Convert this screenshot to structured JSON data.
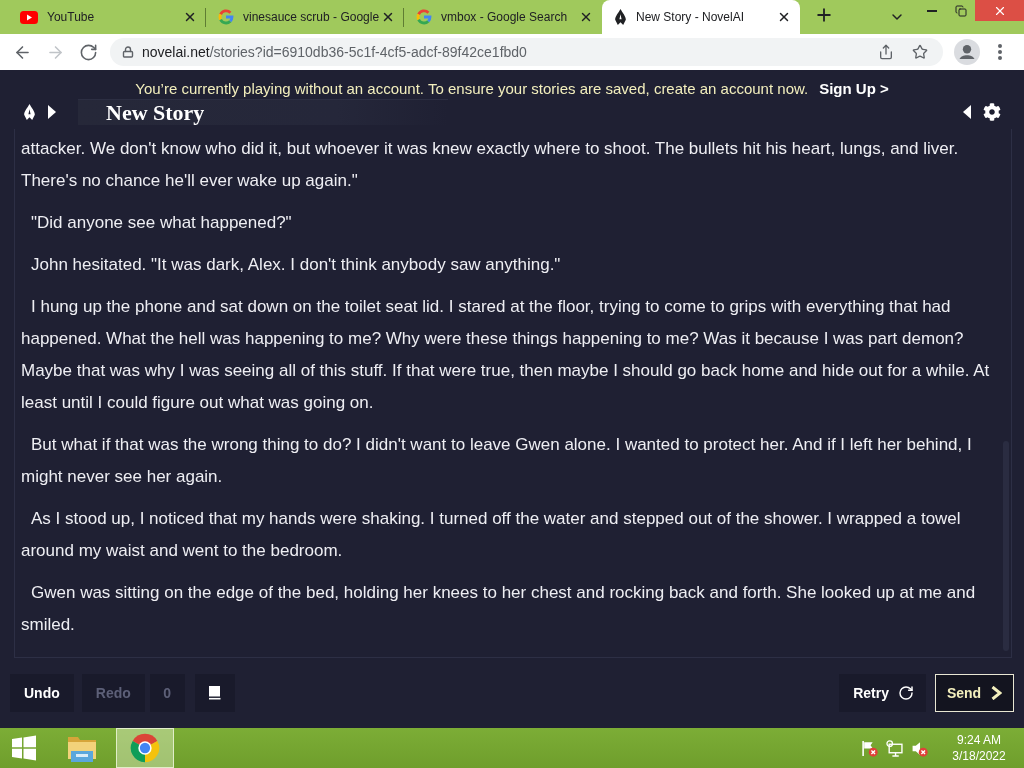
{
  "browser": {
    "tabs": [
      {
        "kind": "play",
        "title": "YouTube",
        "selected": false
      },
      {
        "kind": "letter",
        "title": "vinesauce scrub - Google",
        "selected": false
      },
      {
        "kind": "letter",
        "title": "vmbox - Google Search",
        "selected": false
      },
      {
        "kind": "nib",
        "title": "New Story - NovelAI",
        "selected": true
      }
    ],
    "nav": [
      {
        "kind": "back",
        "disabled": false
      },
      {
        "kind": "forward",
        "disabled": true
      },
      {
        "kind": "reload",
        "disabled": false
      }
    ],
    "address": {
      "host": "novelai.net",
      "path": "/stories?id=6910db36-5c1f-4cf5-adcf-89f42ce1fbd0"
    }
  },
  "banner": {
    "message": "You’re currently playing without an account. To ensure your stories are saved, create an account now.",
    "link": "Sign Up >"
  },
  "header": {
    "title": "New Story"
  },
  "story": {
    "paragraphs": [
      {
        "text": "attacker. We don't know who did it, but whoever it was knew exactly where to shoot. The bullets hit his heart, lungs, and liver. There's no chance he'll ever wake up again.\"",
        "indented": false
      },
      {
        "text": "\"Did anyone see what happened?\"",
        "indented": true
      },
      {
        "text": "John hesitated. \"It was dark, Alex. I don't think anybody saw anything.\"",
        "indented": true
      },
      {
        "text": "I hung up the phone and sat down on the toilet seat lid. I stared at the floor, trying to come to grips with everything that had happened. What the hell was happening to me? Why were these things happening to me? Was it because I was part demon? Maybe that was why I was seeing all of this stuff. If that were true, then maybe I should go back home and hide out for a while. At least until I could figure out what was going on.",
        "indented": true
      },
      {
        "text": "But what if that was the wrong thing to do? I didn't want to leave Gwen alone. I wanted to protect her. And if I left her behind, I might never see her again.",
        "indented": true
      },
      {
        "text": "As I stood up, I noticed that my hands were shaking. I turned off the water and stepped out of the shower. I wrapped a towel around my waist and went to the bedroom.",
        "indented": true
      },
      {
        "text": "Gwen was sitting on the edge of the bed, holding her knees to her chest and rocking back and forth. She looked up at me and smiled.",
        "indented": true
      }
    ]
  },
  "controls": {
    "history": [
      {
        "label": "Undo",
        "disabled": false
      },
      {
        "label": "Redo",
        "disabled": true
      }
    ],
    "redo_count": "0",
    "retry": "Retry",
    "send": "Send"
  },
  "taskbar": {
    "apps": [
      {
        "kind": "explorer",
        "selected": false
      },
      {
        "kind": "chrome",
        "selected": true
      }
    ],
    "tray": [
      {
        "kind": "flag",
        "alert": true
      },
      {
        "kind": "network",
        "alert": false
      },
      {
        "kind": "speaker",
        "alert": true
      }
    ],
    "time": "9:24 AM",
    "date": "3/18/2022"
  }
}
